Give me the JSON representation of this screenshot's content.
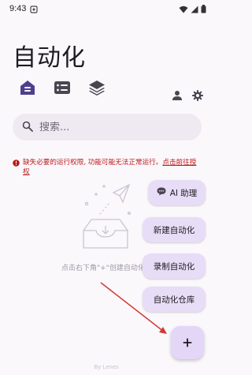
{
  "status_bar": {
    "time": "9:43"
  },
  "header": {
    "title": "自动化"
  },
  "search": {
    "placeholder": "搜索..."
  },
  "warning": {
    "message": "缺失必要的运行权限, 功能可能无法正常运行。",
    "link": "点击前往授权"
  },
  "empty_state": {
    "hint": "点击右下角\"+\"创建自动化"
  },
  "fab_menu": {
    "ai_assistant": "AI 助理",
    "new_automation": "新建自动化",
    "record_automation": "录制自动化",
    "automation_repository": "自动化仓库"
  },
  "footer": {
    "text": "By Lenes"
  },
  "colors": {
    "accent": "#4f3f8f",
    "warning": "#ba1a1a",
    "pill_bg": "#e8ddf7",
    "annotation_arrow": "#d03a33"
  }
}
